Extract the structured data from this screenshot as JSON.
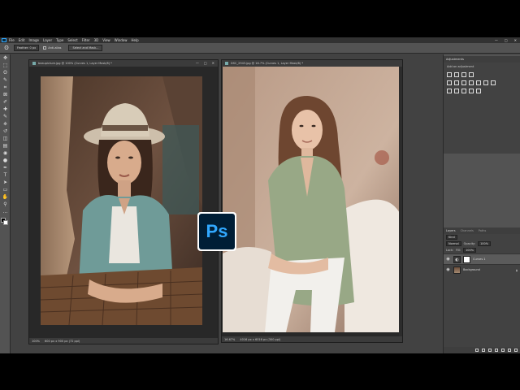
{
  "menubar": {
    "items": [
      "File",
      "Edit",
      "Image",
      "Layer",
      "Type",
      "Select",
      "Filter",
      "3D",
      "View",
      "Window",
      "Help"
    ],
    "window_controls": [
      "—",
      "□",
      "✕"
    ]
  },
  "options_bar": {
    "tool_icon": "lasso-icon",
    "feather_label": "Feather:",
    "feather_value": "0 px",
    "antialias_label": "Anti-alias",
    "select_mask_label": "Select and Mask..."
  },
  "tools": {
    "icons": [
      "move-icon",
      "marquee-icon",
      "lasso-icon",
      "quick-select-icon",
      "crop-icon",
      "frame-icon",
      "eyedropper-icon",
      "healing-icon",
      "brush-icon",
      "stamp-icon",
      "history-brush-icon",
      "eraser-icon",
      "gradient-icon",
      "blur-icon",
      "dodge-icon",
      "pen-icon",
      "type-icon",
      "path-select-icon",
      "rectangle-icon",
      "hand-icon",
      "zoom-icon",
      "more-icon"
    ],
    "glyphs": [
      "✥",
      "⬚",
      "ʘ",
      "✎",
      "⌗",
      "⊠",
      "✐",
      "✚",
      "✎",
      "⎈",
      "↺",
      "◫",
      "▤",
      "◉",
      "●",
      "✒",
      "T",
      "➤",
      "▭",
      "✋",
      "⚲",
      "…"
    ]
  },
  "doc1": {
    "title": "beaupicture.jpg @ 100% (Curves 1, Layer Mask/8) *",
    "zoom": "100%",
    "doc_info": "600 px x 900 px (72 ppi)"
  },
  "doc2": {
    "title": "DSC_2943.jpg @ 16.7% (Curves 1, Layer Mask/8) *",
    "zoom": "16.67%",
    "doc_info": "4016 px x 6016 px (300 ppi)"
  },
  "adjustments": {
    "tab": "Adjustments",
    "hint": "Add an adjustment"
  },
  "layers_panel": {
    "tabs": [
      "Layers",
      "Channels",
      "Paths"
    ],
    "kind_label": "Kind",
    "blend_mode": "Normal",
    "opacity_label": "Opacity:",
    "opacity_value": "100%",
    "lock_label": "Lock:",
    "fill_label": "Fill:",
    "fill_value": "100%",
    "layers": [
      {
        "name": "Curves 1",
        "type": "adjustment"
      },
      {
        "name": "Background",
        "type": "photo"
      }
    ]
  },
  "logo": {
    "text": "Ps",
    "colors": {
      "background": "#001e36",
      "text": "#31a8ff"
    }
  }
}
